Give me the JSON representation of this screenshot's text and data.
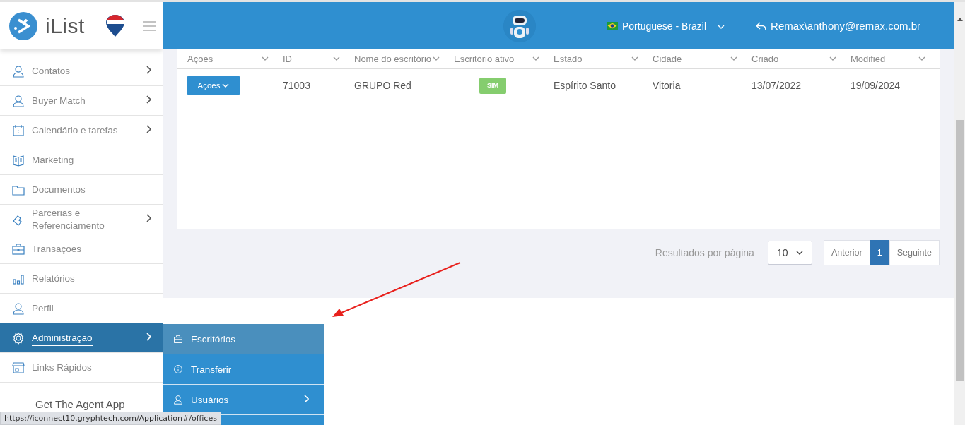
{
  "brand": {
    "name": "iList"
  },
  "sidebar": {
    "items": [
      {
        "label": "Contatos",
        "submenu": true,
        "selected": false
      },
      {
        "label": "Buyer Match",
        "submenu": true,
        "selected": false
      },
      {
        "label": "Calendário e tarefas",
        "submenu": true,
        "selected": false
      },
      {
        "label": "Marketing",
        "submenu": false,
        "selected": false
      },
      {
        "label": "Documentos",
        "submenu": false,
        "selected": false
      },
      {
        "label": "Parcerias e Referenciamento",
        "submenu": true,
        "selected": false
      },
      {
        "label": "Transações",
        "submenu": false,
        "selected": false
      },
      {
        "label": "Relatórios",
        "submenu": false,
        "selected": false
      },
      {
        "label": "Perfil",
        "submenu": false,
        "selected": false
      },
      {
        "label": "Administração",
        "submenu": true,
        "selected": true
      },
      {
        "label": "Links Rápidos",
        "submenu": false,
        "selected": false
      }
    ],
    "footer": "Get The Agent App"
  },
  "submenu": {
    "items": [
      {
        "label": "Escritórios",
        "submenu": false,
        "selected": true
      },
      {
        "label": "Transferir",
        "submenu": false,
        "selected": false
      },
      {
        "label": "Usuários",
        "submenu": true,
        "selected": false
      }
    ]
  },
  "topbar": {
    "language": "Portuguese - Brazil",
    "user": "Remax\\anthony@remax.com.br"
  },
  "table": {
    "columns": [
      "Ações",
      "ID",
      "Nome do escritório",
      "Escritório ativo",
      "Estado",
      "Cidade",
      "Criado",
      "Modified"
    ],
    "rows": [
      {
        "action": "Ações",
        "id": "71003",
        "name": "GRUPO Red",
        "active": "SIM",
        "state": "Espírito Santo",
        "city": "Vitoria",
        "created": "13/07/2022",
        "modified": "19/09/2024"
      }
    ]
  },
  "pagination": {
    "label": "Resultados por página",
    "page_size": "10",
    "previous": "Anterior",
    "pages": [
      {
        "label": "1",
        "selected": true
      }
    ],
    "next": "Seguinte"
  },
  "status_url": "https://iconnect10.gryphtech.com/Application#/offices"
}
